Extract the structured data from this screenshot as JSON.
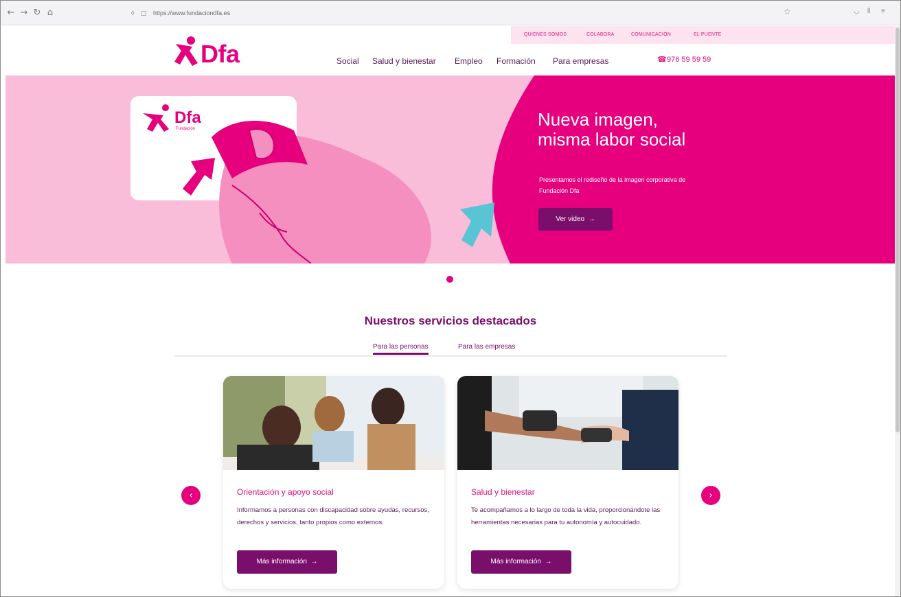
{
  "browser": {
    "url": "https://www.fundaciondfa.es",
    "back_icon": "←",
    "forward_icon": "→",
    "reload_icon": "↻",
    "home_icon": "⌂"
  },
  "topbar": {
    "links": [
      "QUIENES SOMOS",
      "COLABORA",
      "COMUNICACIÓN",
      "EL PUENTE"
    ]
  },
  "header": {
    "logo_text": "Dfa",
    "nav": [
      "Social",
      "Salud y bienestar",
      "Empleo",
      "Formación",
      "Para empresas"
    ],
    "phone": "976 59 59 59"
  },
  "hero": {
    "card_logo_text": "Dfa",
    "card_logo_sub": "Fundación",
    "title": "Nueva imagen, misma labor social",
    "subtitle": "Presentamos el rediseño de la imagen corporativa de Fundación Dfa",
    "button": "Ver video",
    "colors": {
      "pink": "#e6007e",
      "light_pink": "#f9bcd9",
      "purple": "#7a0f6b",
      "cyan": "#5bc4d4"
    }
  },
  "services": {
    "title": "Nuestros servicios destacados",
    "tabs": [
      {
        "label": "Para las personas",
        "active": true
      },
      {
        "label": "Para las empresas",
        "active": false
      }
    ],
    "cards": [
      {
        "title": "Orientación y apoyo social",
        "description": "Informamos a personas con discapacidad sobre ayudas, recursos, derechos y servicios, tanto propios como externos.",
        "button": "Más información"
      },
      {
        "title": "Salud y bienestar",
        "description": "Te acompañamos a lo largo de toda la vida, proporcionándote las herramientas necesarias para tu autonomía y autocuidado.",
        "button": "Más información"
      }
    ],
    "prev_icon": "‹",
    "next_icon": "›"
  }
}
